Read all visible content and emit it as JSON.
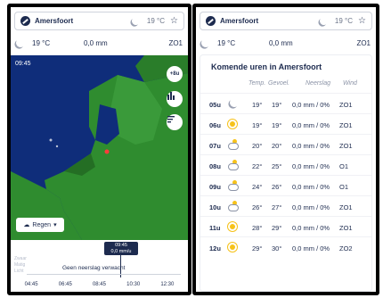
{
  "location": {
    "name": "Amersfoort",
    "current_temp": "19 °C"
  },
  "conditions": {
    "temp": "19 °C",
    "precip": "0,0 mm",
    "wind": "ZO1"
  },
  "map": {
    "time": "09:45",
    "plus_button": "+8u",
    "regen_label": "Regen",
    "timeline_tip_time": "09:45",
    "timeline_tip_value": "0,0 mm/u",
    "levels": [
      "Zwaar",
      "Matig",
      "Licht"
    ],
    "no_rain_msg": "Geen neerslag verwacht",
    "ticks": [
      "04:45",
      "06:45",
      "08:45",
      "10:30",
      "12:30"
    ]
  },
  "forecast": {
    "title": "Komende uren in Amersfoort",
    "headers": {
      "temp": "Temp.",
      "feel": "Gevoel.",
      "rain": "Neerslag",
      "wind": "Wind"
    },
    "rows": [
      {
        "hour": "05u",
        "icon": "moon",
        "temp": "19°",
        "feel": "19°",
        "rain": "0,0 mm / 0%",
        "wind": "ZO1"
      },
      {
        "hour": "06u",
        "icon": "sun",
        "temp": "19°",
        "feel": "19°",
        "rain": "0,0 mm / 0%",
        "wind": "ZO1"
      },
      {
        "hour": "07u",
        "icon": "partly-cloudy",
        "temp": "20°",
        "feel": "20°",
        "rain": "0,0 mm / 0%",
        "wind": "ZO1"
      },
      {
        "hour": "08u",
        "icon": "partly-cloudy",
        "temp": "22°",
        "feel": "25°",
        "rain": "0,0 mm / 0%",
        "wind": "O1"
      },
      {
        "hour": "09u",
        "icon": "partly-cloudy",
        "temp": "24°",
        "feel": "26°",
        "rain": "0,0 mm / 0%",
        "wind": "O1"
      },
      {
        "hour": "10u",
        "icon": "partly-cloudy",
        "temp": "26°",
        "feel": "27°",
        "rain": "0,0 mm / 0%",
        "wind": "ZO1"
      },
      {
        "hour": "11u",
        "icon": "sun",
        "temp": "28°",
        "feel": "29°",
        "rain": "0,0 mm / 0%",
        "wind": "ZO1"
      },
      {
        "hour": "12u",
        "icon": "sun",
        "temp": "29°",
        "feel": "30°",
        "rain": "0,0 mm / 0%",
        "wind": "ZO2"
      }
    ]
  },
  "colors": {
    "navy": "#1d2b4f",
    "map_sea": "#0f2d7a",
    "land": "#2f8c2f",
    "sun": "#f6c21a"
  }
}
